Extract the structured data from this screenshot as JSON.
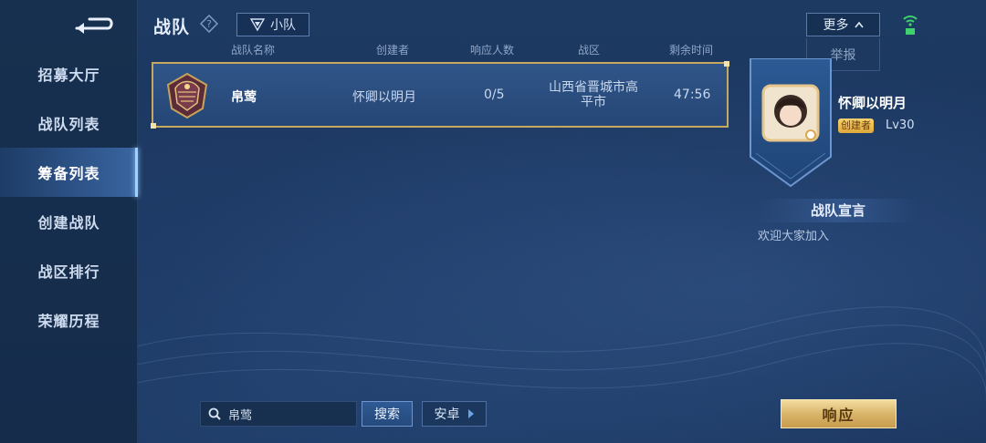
{
  "sidebar": {
    "items": [
      {
        "label": "招募大厅"
      },
      {
        "label": "战队列表"
      },
      {
        "label": "筹备列表",
        "active": true
      },
      {
        "label": "创建战队"
      },
      {
        "label": "战区排行"
      },
      {
        "label": "荣耀历程"
      }
    ]
  },
  "header": {
    "title": "战队",
    "squad_button": "小队",
    "more_button": "更多",
    "report_item": "举报"
  },
  "table": {
    "columns": [
      "战队名称",
      "创建者",
      "响应人数",
      "战区",
      "剩余时间"
    ],
    "rows": [
      {
        "name": "帛莺",
        "creator": "怀卿以明月",
        "responses": "0/5",
        "region_line1": "山西省晋城市高",
        "region_line2": "平市",
        "time_left": "47:56"
      }
    ]
  },
  "detail": {
    "creator_name": "怀卿以明月",
    "creator_badge": "创建者",
    "level": "Lv30",
    "declaration_title": "战队宣言",
    "declaration_text": "欢迎大家加入"
  },
  "bottom": {
    "search_value": "帛莺",
    "search_button": "搜索",
    "platform_button": "安卓",
    "respond_button": "响应"
  },
  "colors": {
    "accent_gold": "#c7a860",
    "active_nav": "#4678be",
    "wifi_green": "#3fd26b"
  }
}
